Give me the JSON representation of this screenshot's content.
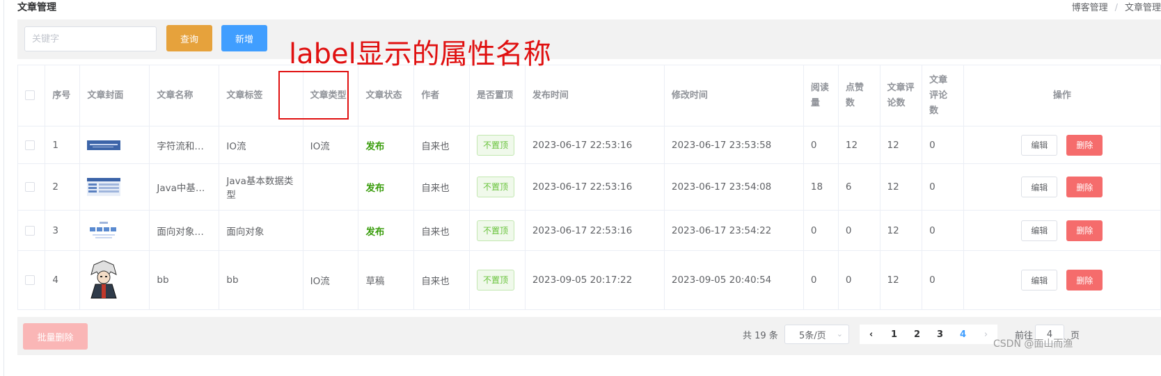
{
  "page": {
    "title": "文章管理"
  },
  "breadcrumb": [
    "博客管理",
    "文章管理"
  ],
  "toolbar": {
    "search_placeholder": "关键字",
    "query_label": "查询",
    "add_label": "新增"
  },
  "annotation": {
    "text": "label显示的属性名称"
  },
  "table": {
    "headers": {
      "index": "序号",
      "cover": "文章封面",
      "name": "文章名称",
      "tags": "文章标签",
      "type": "文章类型",
      "status": "文章状态",
      "author": "作者",
      "top": "是否置顶",
      "publish_time": "发布时间",
      "modify_time": "修改时间",
      "views": "阅读量",
      "likes": "点赞数",
      "comments1": "文章评论数",
      "comments2": "文章评论数",
      "actions": "操作"
    },
    "rows": [
      {
        "index": "1",
        "name": "字符流和…",
        "tags": "IO流",
        "type": "IO流",
        "status": "发布",
        "author": "自来也",
        "top": "不置顶",
        "publish_time": "2023-06-17 22:53:16",
        "modify_time": "2023-06-17 23:53:58",
        "views": "0",
        "likes": "12",
        "comments1": "12",
        "comments2": "0",
        "edit": "编辑",
        "delete": "删除"
      },
      {
        "index": "2",
        "name": "Java中基…",
        "tags": "Java基本数据类型",
        "type": "",
        "status": "发布",
        "author": "自来也",
        "top": "不置顶",
        "publish_time": "2023-06-17 22:53:16",
        "modify_time": "2023-06-17 23:54:08",
        "views": "18",
        "likes": "6",
        "comments1": "12",
        "comments2": "0",
        "edit": "编辑",
        "delete": "删除"
      },
      {
        "index": "3",
        "name": "面向对象…",
        "tags": "面向对象",
        "type": "",
        "status": "发布",
        "author": "自来也",
        "top": "不置顶",
        "publish_time": "2023-06-17 22:53:16",
        "modify_time": "2023-06-17 23:54:22",
        "views": "0",
        "likes": "0",
        "comments1": "12",
        "comments2": "0",
        "edit": "编辑",
        "delete": "删除"
      },
      {
        "index": "4",
        "name": "bb",
        "tags": "bb",
        "type": "IO流",
        "status": "草稿",
        "author": "自来也",
        "top": "不置顶",
        "publish_time": "2023-09-05 20:17:22",
        "modify_time": "2023-09-05 20:40:54",
        "views": "0",
        "likes": "0",
        "comments1": "12",
        "comments2": "0",
        "edit": "编辑",
        "delete": "删除"
      }
    ]
  },
  "footer": {
    "batch_delete_label": "批量删除",
    "total_label": "共 19 条",
    "page_size_label": "5条/页",
    "prev_icon": "‹",
    "next_icon": "›",
    "pages": [
      "1",
      "2",
      "3",
      "4"
    ],
    "current_page": "4",
    "jump_prefix": "前往",
    "jump_value": "4",
    "jump_suffix": "页"
  },
  "watermark": "CSDN @面山而渔",
  "colors": {
    "query": "#e6a23c",
    "add": "#409eff",
    "delete": "#f56c6c",
    "published": "#3a9d0d",
    "annotation": "#e01010"
  },
  "icons": [
    "checkbox-icon",
    "chevron-down-icon",
    "chevron-left-icon",
    "chevron-right-icon"
  ]
}
